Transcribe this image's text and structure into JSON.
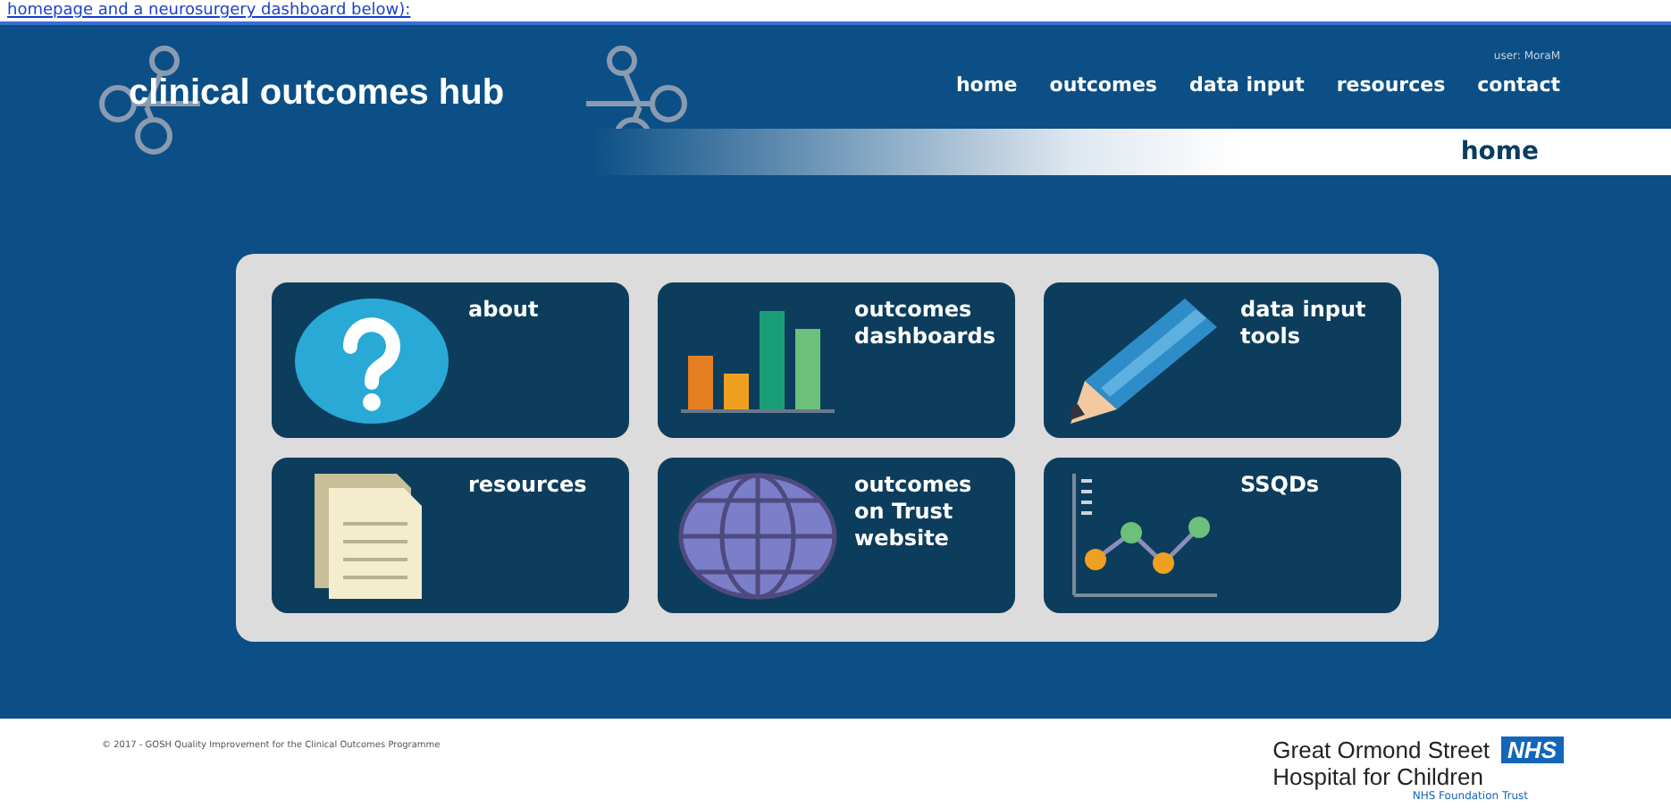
{
  "top_link": "homepage and a neurosurgery dashboard below):",
  "logo": "clinical outcomes hub",
  "user": "user: MoraM",
  "nav": [
    "home",
    "outcomes",
    "data input",
    "resources",
    "contact"
  ],
  "page_title": "home",
  "tiles": [
    {
      "kind": "question",
      "label": "about"
    },
    {
      "kind": "bars",
      "label": "outcomes\ndashboards"
    },
    {
      "kind": "pencil",
      "label": "data input\ntools"
    },
    {
      "kind": "document",
      "label": "resources"
    },
    {
      "kind": "globe",
      "label": "outcomes\non Trust\nwebsite"
    },
    {
      "kind": "linechart",
      "label": "SSQDs"
    }
  ],
  "footer": {
    "copyright": "© 2017 - GOSH Quality Improvement for the Clinical Outcomes Programme",
    "org_line1": "Great Ormond Street",
    "org_badge": "NHS",
    "org_line2": "Hospital for Children",
    "org_line3": "NHS Foundation Trust"
  }
}
